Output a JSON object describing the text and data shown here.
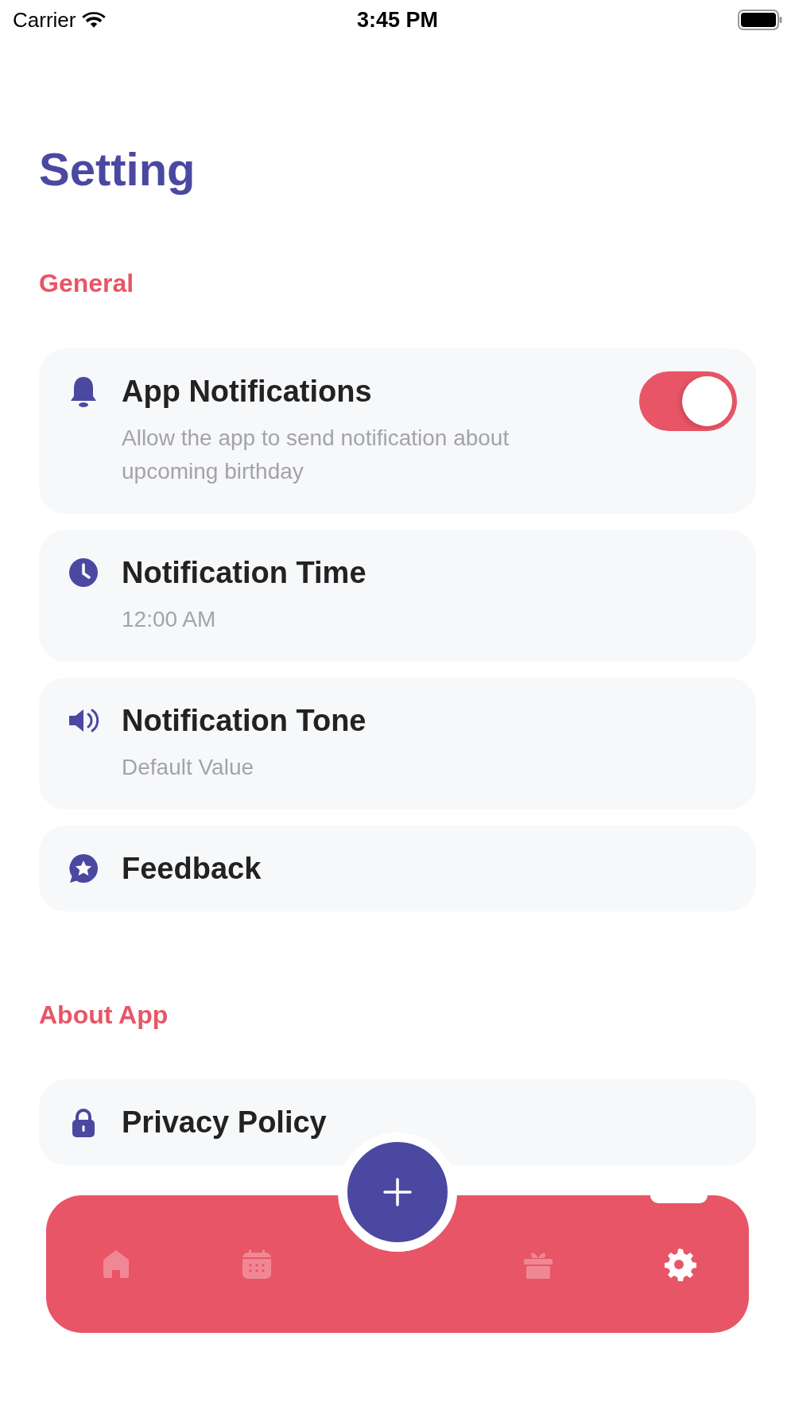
{
  "status_bar": {
    "carrier": "Carrier",
    "time": "3:45 PM"
  },
  "title": "Setting",
  "sections": [
    {
      "heading": "General",
      "items": [
        {
          "kind": "toggle",
          "title": "App Notifications",
          "subtitle": "Allow the app to send notification about upcoming birthday",
          "on": true
        },
        {
          "kind": "plain",
          "title": "Notification Time",
          "subtitle": "12:00 AM"
        },
        {
          "kind": "plain",
          "title": "Notification Tone",
          "subtitle": "Default Value"
        },
        {
          "kind": "plain",
          "title": "Feedback"
        }
      ]
    },
    {
      "heading": "About App",
      "items": [
        {
          "kind": "plain",
          "title": "Privacy Policy"
        }
      ]
    }
  ],
  "tab_bar": {
    "items": [
      {
        "selected": false
      },
      {
        "selected": false
      },
      {
        "selected": false
      },
      {
        "selected": true
      }
    ]
  }
}
